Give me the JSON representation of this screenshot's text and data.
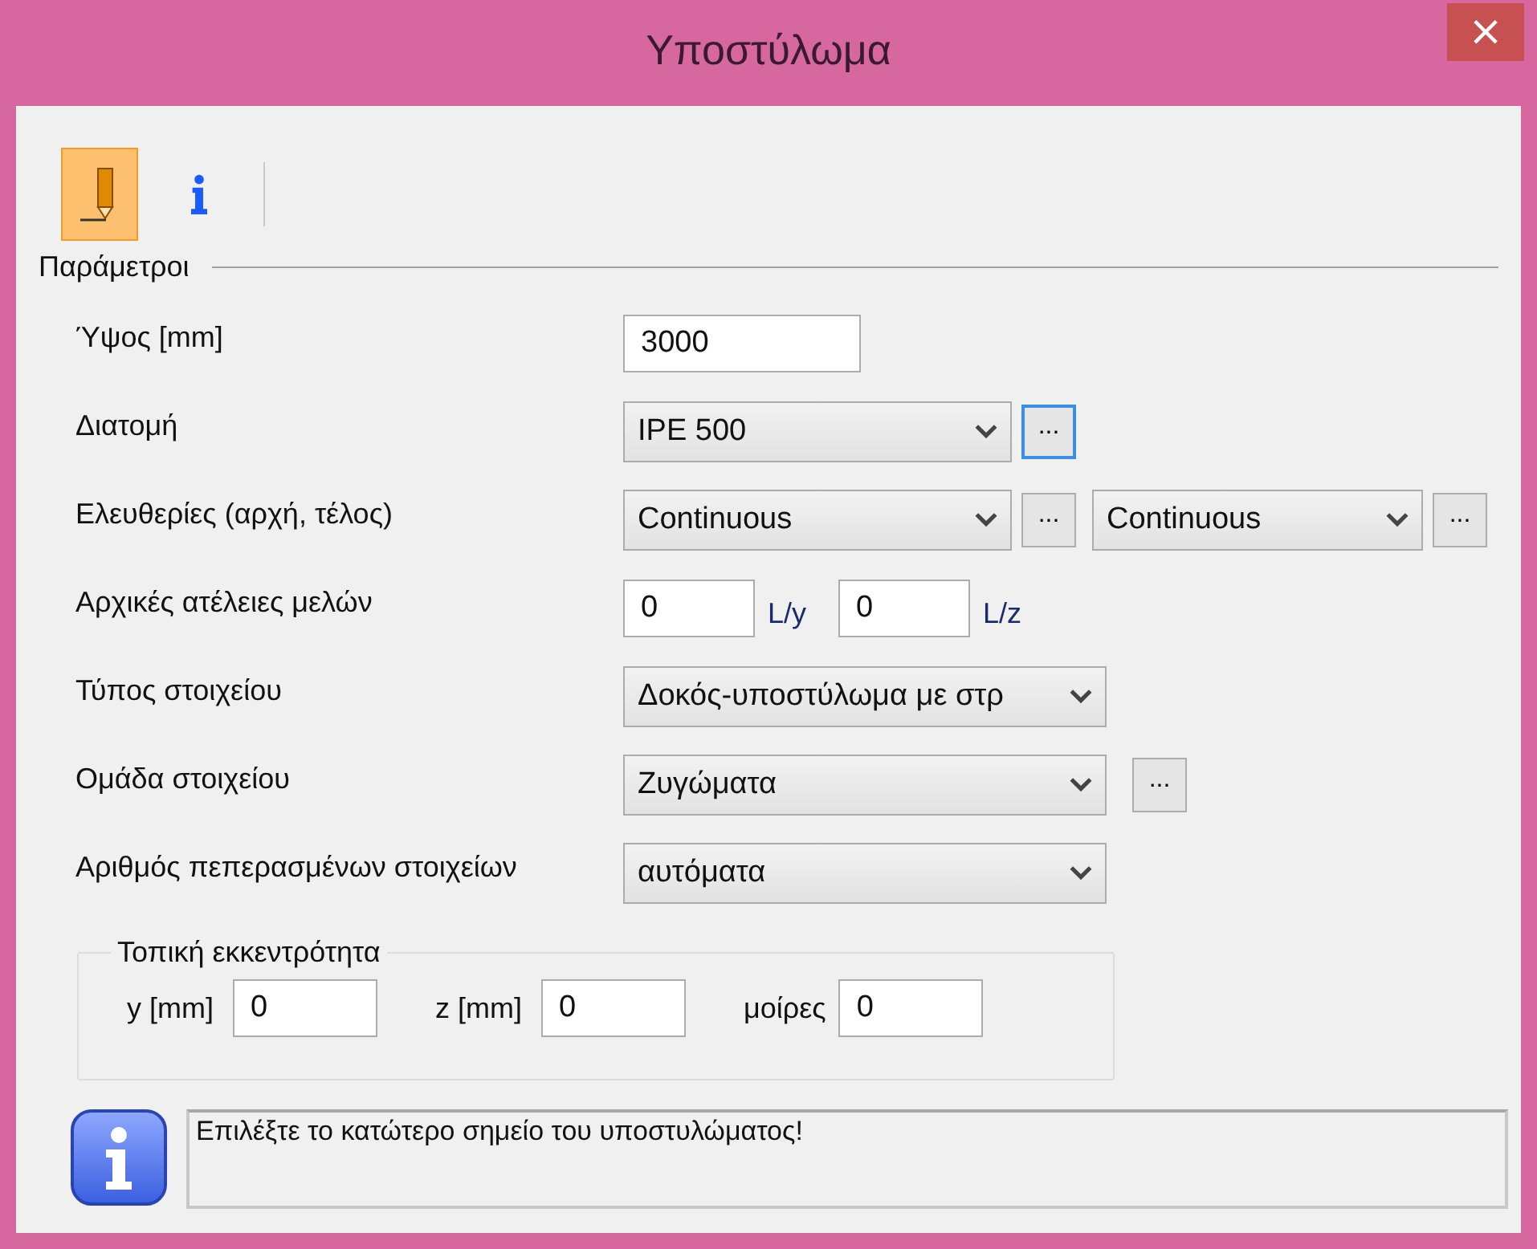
{
  "window": {
    "title": "Υποστύλωμα",
    "close": "×"
  },
  "toolbar": [
    {
      "kind": "pencil",
      "selected": true
    },
    {
      "kind": "info",
      "selected": false
    }
  ],
  "section": {
    "title": "Παράμετροι"
  },
  "fields": [
    {
      "label": "Ύψος [mm]",
      "controls": [
        {
          "kind": "input",
          "value": "3000"
        }
      ]
    },
    {
      "label": "Διατομή",
      "controls": [
        {
          "kind": "select",
          "value": "IPE 500",
          "button": "...",
          "focused": true
        }
      ]
    },
    {
      "label": "Ελευθερίες (αρχή, τέλος)",
      "controls": [
        {
          "kind": "select",
          "value": "Continuous",
          "button": "...",
          "focused": false
        },
        {
          "kind": "short-select",
          "value": "Continuous",
          "button": "...",
          "focused": false
        }
      ]
    },
    {
      "label": "Αρχικές ατέλειες μελών",
      "controls": [
        {
          "kind": "small-input",
          "value": "0",
          "unit": "L/y"
        },
        {
          "kind": "small-input",
          "value": "0",
          "unit": "L/z"
        }
      ]
    },
    {
      "label": "Τύπος στοιχείου",
      "controls": [
        {
          "kind": "wide-select",
          "value": "Δοκός-υποστύλωμα με στρ"
        }
      ]
    },
    {
      "label": "Ομάδα στοιχείου",
      "controls": [
        {
          "kind": "wide-select",
          "value": "Ζυγώματα",
          "button": "...",
          "focused": false
        }
      ]
    },
    {
      "label": "Αριθμός πεπερασμένων στοιχείων",
      "controls": [
        {
          "kind": "wide-select",
          "value": "αυτόματα"
        }
      ]
    }
  ],
  "eccentricity": {
    "title": "Τοπική εκκεντρότητα",
    "fields": [
      {
        "label": "y [mm]",
        "value": "0"
      },
      {
        "label": "z [mm]",
        "value": "0"
      },
      {
        "label": "μοίρες",
        "value": "0"
      }
    ]
  },
  "message": {
    "text": "Επιλέξτε το κατώτερο σημείο του υποστυλώματος!"
  }
}
